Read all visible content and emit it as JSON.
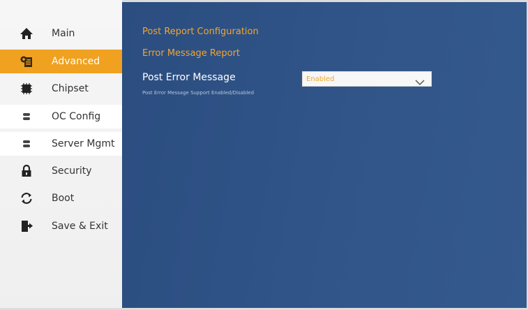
{
  "sidebar": {
    "items": [
      {
        "label": "Main",
        "icon": "home-icon"
      },
      {
        "label": "Advanced",
        "icon": "gear-doc-icon",
        "active": true
      },
      {
        "label": "Chipset",
        "icon": "chip-icon"
      },
      {
        "label": "OC Config",
        "icon": "toggle-icon"
      },
      {
        "label": "Server Mgmt",
        "icon": "toggle-icon"
      },
      {
        "label": "Security",
        "icon": "lock-icon"
      },
      {
        "label": "Boot",
        "icon": "refresh-icon"
      },
      {
        "label": "Save & Exit",
        "icon": "exit-icon"
      }
    ]
  },
  "main": {
    "section_title": "Post Report Configuration",
    "subsection_title": "Error Message Report",
    "setting": {
      "label": "Post Error Message",
      "value": "Enabled",
      "help": "Post Error Message Support Enabled/Disabled"
    }
  },
  "colors": {
    "accent": "#f0a11f",
    "content_bg": "#2f5286",
    "sidebar_bg": "#f4f4f4"
  }
}
